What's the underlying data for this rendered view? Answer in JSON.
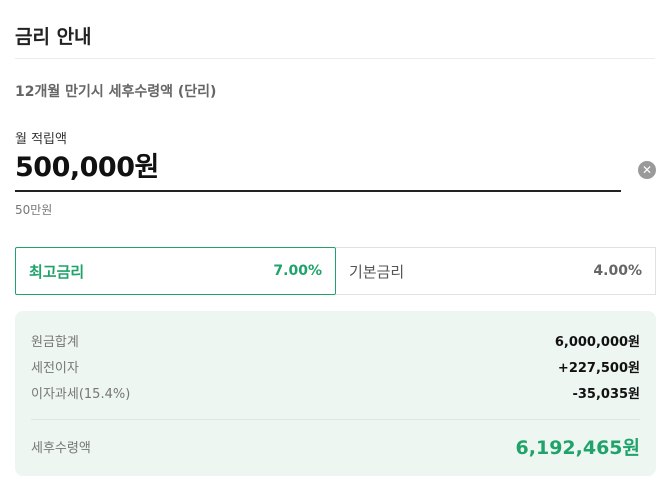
{
  "header": {
    "title": "금리 안내"
  },
  "subtitle": "12개월 만기시 세후수령액 (단리)",
  "deposit": {
    "label": "월 적립액",
    "value": "500,000원",
    "hint": "50만원",
    "clear_icon": "close-circle-icon"
  },
  "rates": [
    {
      "name": "최고금리",
      "value": "7.00%",
      "active": true
    },
    {
      "name": "기본금리",
      "value": "4.00%",
      "active": false
    }
  ],
  "summary": {
    "rows": [
      {
        "label": "원금합계",
        "value": "6,000,000원"
      },
      {
        "label": "세전이자",
        "value": "+227,500원"
      },
      {
        "label": "이자과세(15.4%)",
        "value": "-35,035원"
      }
    ],
    "total": {
      "label": "세후수령액",
      "value": "6,192,465원"
    }
  },
  "colors": {
    "accent": "#1fa36a",
    "summary_bg": "#eef6f1"
  }
}
